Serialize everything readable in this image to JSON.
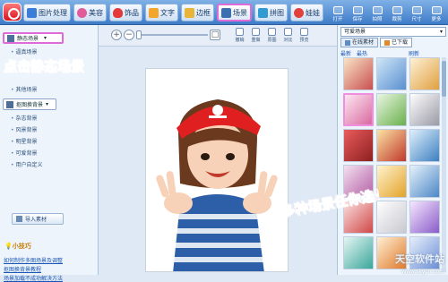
{
  "toolbar": {
    "tabs": [
      {
        "label": "图片处理",
        "icon": "photo-icon",
        "color": "#3b7dd8"
      },
      {
        "label": "美容",
        "icon": "beauty-icon",
        "color": "#e05d9a"
      },
      {
        "label": "饰品",
        "icon": "heart-icon",
        "color": "#e23a3a"
      },
      {
        "label": "文字",
        "icon": "text-icon",
        "color": "#f2a72a"
      },
      {
        "label": "边框",
        "icon": "frame-icon",
        "color": "#e8b43a"
      },
      {
        "label": "场景",
        "icon": "scene-icon",
        "color": "#3b6fb0"
      },
      {
        "label": "拼图",
        "icon": "puzzle-icon",
        "color": "#2f9bd1"
      },
      {
        "label": "娃娃",
        "icon": "doll-icon",
        "color": "#e2403a"
      }
    ],
    "actions": [
      "打开",
      "保存",
      "拍照",
      "裁剪",
      "尺寸",
      "更多"
    ]
  },
  "left_panel": {
    "static_scene": "静态场景",
    "overlay_hint": "点击静态场景",
    "group1": [
      "逼真场景",
      "...",
      "...",
      "其他场景"
    ],
    "cutout_bg": "抠图换背景",
    "group2": [
      "杂志背景",
      "风景背景",
      "明星背景",
      "可爱背景",
      "用户自定义"
    ],
    "import": "导入素材",
    "tips_title": "小技巧",
    "tips": [
      "如何制作多图场景及调整",
      "抠图换背景教程",
      "场景加载不成功解决方法"
    ]
  },
  "edit_bar": {
    "buttons": [
      "撤销",
      "重做",
      "原图",
      "对比",
      "预览"
    ]
  },
  "right_panel": {
    "scene_select": "可爱场景",
    "tabs": [
      "在线素材",
      "已下载"
    ],
    "cats": [
      "最新",
      "最热",
      "刷新"
    ],
    "overlay": "多种场景任你选！",
    "watermark": "天空软件站",
    "watermark_url": "www.skycn.com"
  }
}
